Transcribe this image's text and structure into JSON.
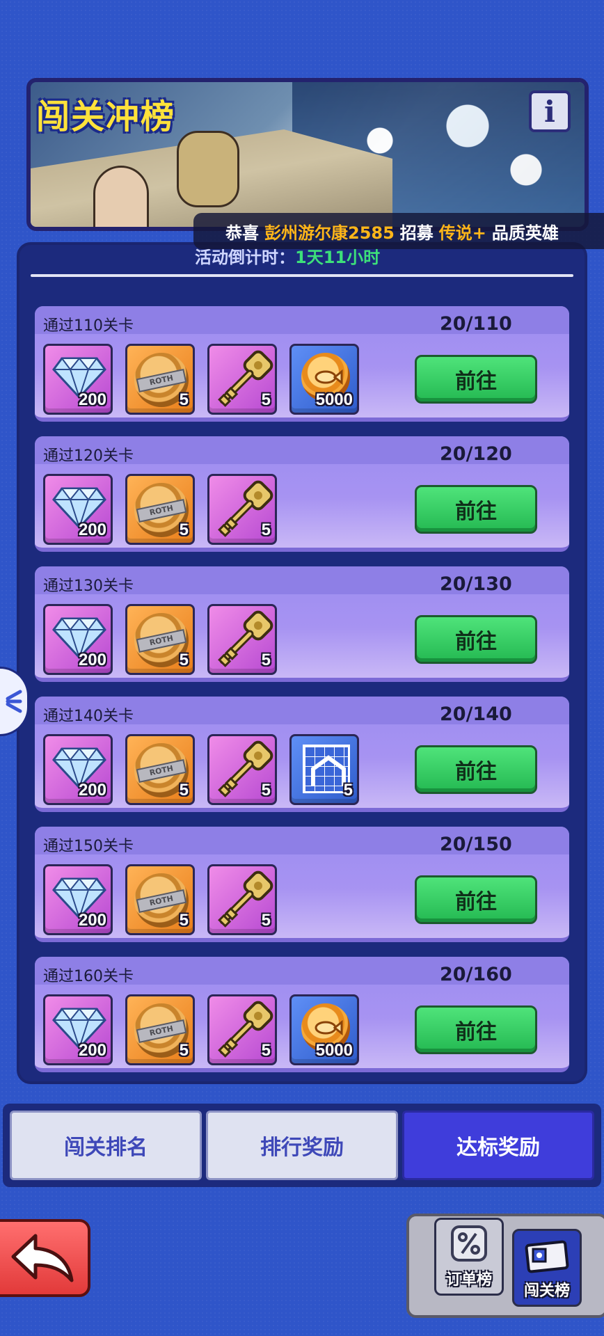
{
  "banner": {
    "title": "闯关冲榜",
    "info_label": "i"
  },
  "ticker": {
    "prefix": "恭喜",
    "player": "彭州游尔康2585",
    "verb": "招募",
    "quality": "传说+",
    "suffix": "品质英雄"
  },
  "countdown": {
    "label": "活动倒计时：",
    "value": "1天11小时"
  },
  "go_label": "前往",
  "items": {
    "gem": {
      "icon": "diamond-icon",
      "qty": "200"
    },
    "token": {
      "icon": "roth-token-icon",
      "qty": "5",
      "text": "ROTH"
    },
    "key": {
      "icon": "golden-key-icon",
      "qty": "5"
    },
    "coin": {
      "icon": "fish-coin-icon",
      "qty": "5000"
    },
    "house": {
      "icon": "building-blueprint-icon",
      "qty": "5"
    }
  },
  "tasks": [
    {
      "title": "通过110关卡",
      "progress": "20/110"
    },
    {
      "title": "通过120关卡",
      "progress": "20/120"
    },
    {
      "title": "通过130关卡",
      "progress": "20/130"
    },
    {
      "title": "通过140关卡",
      "progress": "20/140"
    },
    {
      "title": "通过150关卡",
      "progress": "20/150"
    },
    {
      "title": "通过160关卡",
      "progress": "20/160"
    }
  ],
  "tabs": [
    {
      "label": "闯关排名",
      "active": false
    },
    {
      "label": "排行奖励",
      "active": false
    },
    {
      "label": "达标奖励",
      "active": true
    }
  ],
  "bottom_nav": [
    {
      "label": "订单榜",
      "icon": "percent-badge-icon"
    },
    {
      "label": "闯关榜",
      "icon": "ticket-card-icon"
    }
  ],
  "colors": {
    "background": "#2f55c9",
    "go_button": "#24b952",
    "active_tab": "#3f3ddb",
    "highlight": "#ffb619"
  }
}
